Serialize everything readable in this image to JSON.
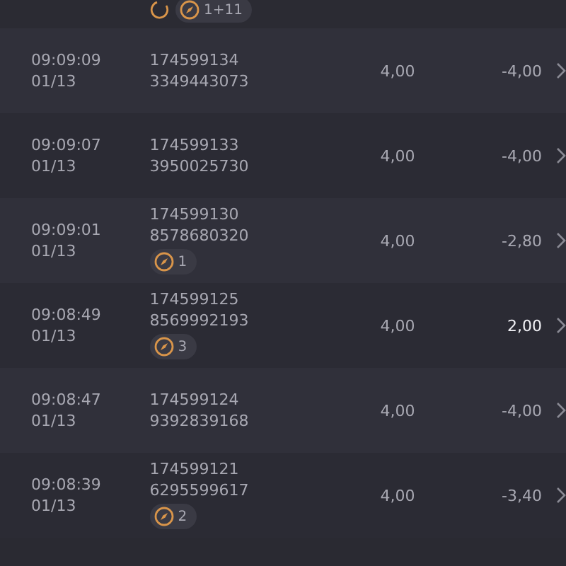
{
  "top_row": {
    "badges": [
      {
        "kind": "spinner"
      },
      {
        "kind": "compass",
        "count": "1+11"
      }
    ]
  },
  "rows": [
    {
      "time": "09:09:09",
      "date": "01/13",
      "id": "174599134",
      "ref": "3349443073",
      "amount": "4,00",
      "result": "-4,00",
      "highlight": false
    },
    {
      "time": "09:09:07",
      "date": "01/13",
      "id": "174599133",
      "ref": "3950025730",
      "amount": "4,00",
      "result": "-4,00",
      "highlight": false
    },
    {
      "time": "09:09:01",
      "date": "01/13",
      "id": "174599130",
      "ref": "8578680320",
      "badge": "1",
      "amount": "4,00",
      "result": "-2,80",
      "highlight": false
    },
    {
      "time": "09:08:49",
      "date": "01/13",
      "id": "174599125",
      "ref": "8569992193",
      "badge": "3",
      "amount": "4,00",
      "result": "2,00",
      "highlight": true
    },
    {
      "time": "09:08:47",
      "date": "01/13",
      "id": "174599124",
      "ref": "9392839168",
      "amount": "4,00",
      "result": "-4,00",
      "highlight": false
    },
    {
      "time": "09:08:39",
      "date": "01/13",
      "id": "174599121",
      "ref": "6295599617",
      "badge": "2",
      "amount": "4,00",
      "result": "-3,40",
      "highlight": false
    }
  ]
}
